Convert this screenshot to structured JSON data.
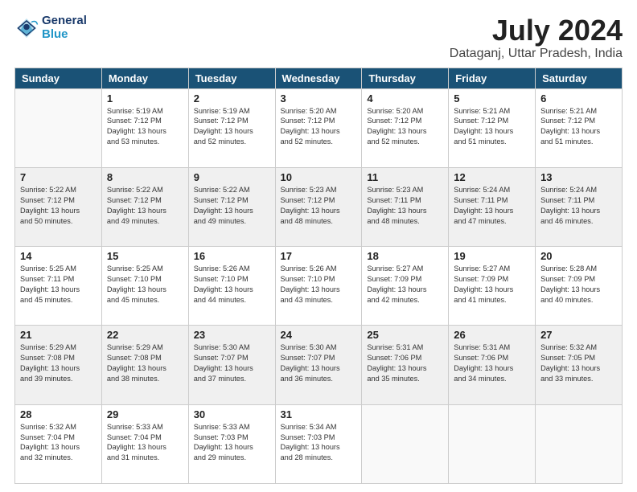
{
  "header": {
    "logo_line1": "General",
    "logo_line2": "Blue",
    "title": "July 2024",
    "subtitle": "Dataganj, Uttar Pradesh, India"
  },
  "days_of_week": [
    "Sunday",
    "Monday",
    "Tuesday",
    "Wednesday",
    "Thursday",
    "Friday",
    "Saturday"
  ],
  "weeks": [
    [
      {
        "date": "",
        "info": ""
      },
      {
        "date": "1",
        "info": "Sunrise: 5:19 AM\nSunset: 7:12 PM\nDaylight: 13 hours\nand 53 minutes."
      },
      {
        "date": "2",
        "info": "Sunrise: 5:19 AM\nSunset: 7:12 PM\nDaylight: 13 hours\nand 52 minutes."
      },
      {
        "date": "3",
        "info": "Sunrise: 5:20 AM\nSunset: 7:12 PM\nDaylight: 13 hours\nand 52 minutes."
      },
      {
        "date": "4",
        "info": "Sunrise: 5:20 AM\nSunset: 7:12 PM\nDaylight: 13 hours\nand 52 minutes."
      },
      {
        "date": "5",
        "info": "Sunrise: 5:21 AM\nSunset: 7:12 PM\nDaylight: 13 hours\nand 51 minutes."
      },
      {
        "date": "6",
        "info": "Sunrise: 5:21 AM\nSunset: 7:12 PM\nDaylight: 13 hours\nand 51 minutes."
      }
    ],
    [
      {
        "date": "7",
        "info": "Sunrise: 5:22 AM\nSunset: 7:12 PM\nDaylight: 13 hours\nand 50 minutes."
      },
      {
        "date": "8",
        "info": "Sunrise: 5:22 AM\nSunset: 7:12 PM\nDaylight: 13 hours\nand 49 minutes."
      },
      {
        "date": "9",
        "info": "Sunrise: 5:22 AM\nSunset: 7:12 PM\nDaylight: 13 hours\nand 49 minutes."
      },
      {
        "date": "10",
        "info": "Sunrise: 5:23 AM\nSunset: 7:12 PM\nDaylight: 13 hours\nand 48 minutes."
      },
      {
        "date": "11",
        "info": "Sunrise: 5:23 AM\nSunset: 7:11 PM\nDaylight: 13 hours\nand 48 minutes."
      },
      {
        "date": "12",
        "info": "Sunrise: 5:24 AM\nSunset: 7:11 PM\nDaylight: 13 hours\nand 47 minutes."
      },
      {
        "date": "13",
        "info": "Sunrise: 5:24 AM\nSunset: 7:11 PM\nDaylight: 13 hours\nand 46 minutes."
      }
    ],
    [
      {
        "date": "14",
        "info": "Sunrise: 5:25 AM\nSunset: 7:11 PM\nDaylight: 13 hours\nand 45 minutes."
      },
      {
        "date": "15",
        "info": "Sunrise: 5:25 AM\nSunset: 7:10 PM\nDaylight: 13 hours\nand 45 minutes."
      },
      {
        "date": "16",
        "info": "Sunrise: 5:26 AM\nSunset: 7:10 PM\nDaylight: 13 hours\nand 44 minutes."
      },
      {
        "date": "17",
        "info": "Sunrise: 5:26 AM\nSunset: 7:10 PM\nDaylight: 13 hours\nand 43 minutes."
      },
      {
        "date": "18",
        "info": "Sunrise: 5:27 AM\nSunset: 7:09 PM\nDaylight: 13 hours\nand 42 minutes."
      },
      {
        "date": "19",
        "info": "Sunrise: 5:27 AM\nSunset: 7:09 PM\nDaylight: 13 hours\nand 41 minutes."
      },
      {
        "date": "20",
        "info": "Sunrise: 5:28 AM\nSunset: 7:09 PM\nDaylight: 13 hours\nand 40 minutes."
      }
    ],
    [
      {
        "date": "21",
        "info": "Sunrise: 5:29 AM\nSunset: 7:08 PM\nDaylight: 13 hours\nand 39 minutes."
      },
      {
        "date": "22",
        "info": "Sunrise: 5:29 AM\nSunset: 7:08 PM\nDaylight: 13 hours\nand 38 minutes."
      },
      {
        "date": "23",
        "info": "Sunrise: 5:30 AM\nSunset: 7:07 PM\nDaylight: 13 hours\nand 37 minutes."
      },
      {
        "date": "24",
        "info": "Sunrise: 5:30 AM\nSunset: 7:07 PM\nDaylight: 13 hours\nand 36 minutes."
      },
      {
        "date": "25",
        "info": "Sunrise: 5:31 AM\nSunset: 7:06 PM\nDaylight: 13 hours\nand 35 minutes."
      },
      {
        "date": "26",
        "info": "Sunrise: 5:31 AM\nSunset: 7:06 PM\nDaylight: 13 hours\nand 34 minutes."
      },
      {
        "date": "27",
        "info": "Sunrise: 5:32 AM\nSunset: 7:05 PM\nDaylight: 13 hours\nand 33 minutes."
      }
    ],
    [
      {
        "date": "28",
        "info": "Sunrise: 5:32 AM\nSunset: 7:04 PM\nDaylight: 13 hours\nand 32 minutes."
      },
      {
        "date": "29",
        "info": "Sunrise: 5:33 AM\nSunset: 7:04 PM\nDaylight: 13 hours\nand 31 minutes."
      },
      {
        "date": "30",
        "info": "Sunrise: 5:33 AM\nSunset: 7:03 PM\nDaylight: 13 hours\nand 29 minutes."
      },
      {
        "date": "31",
        "info": "Sunrise: 5:34 AM\nSunset: 7:03 PM\nDaylight: 13 hours\nand 28 minutes."
      },
      {
        "date": "",
        "info": ""
      },
      {
        "date": "",
        "info": ""
      },
      {
        "date": "",
        "info": ""
      }
    ]
  ]
}
